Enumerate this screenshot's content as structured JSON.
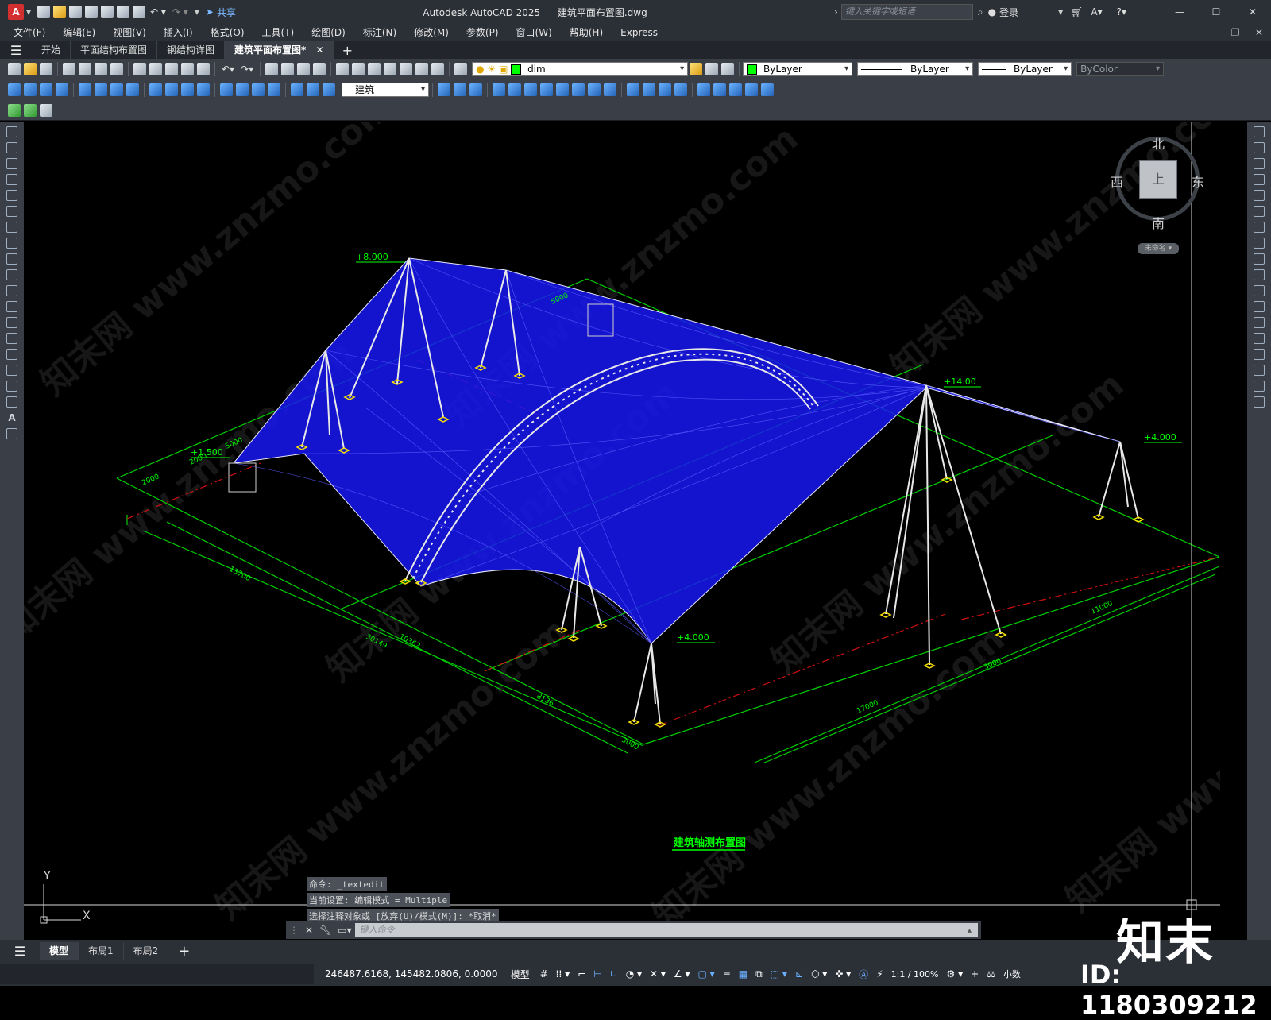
{
  "titlebar": {
    "app_title": "Autodesk AutoCAD 2025",
    "file_name": "建筑平面布置图.dwg",
    "share_label": "共享",
    "search_placeholder": "键入关键字或短语",
    "login_label": "登录"
  },
  "menubar": {
    "items": [
      "文件(F)",
      "编辑(E)",
      "视图(V)",
      "插入(I)",
      "格式(O)",
      "工具(T)",
      "绘图(D)",
      "标注(N)",
      "修改(M)",
      "参数(P)",
      "窗口(W)",
      "帮助(H)",
      "Express"
    ]
  },
  "doc_tabs": {
    "items": [
      "开始",
      "平面结构布置图",
      "钢结构详图",
      "建筑平面布置图*"
    ],
    "active_index": 3
  },
  "toolbar1": {
    "layer_name": "dim",
    "color": "ByLayer",
    "linetype": "ByLayer",
    "lineweight": "ByLayer",
    "plotstyle": "ByColor"
  },
  "toolbar2": {
    "textstyle": "建筑"
  },
  "viewcube": {
    "north": "北",
    "south": "南",
    "east": "东",
    "west": "西",
    "face": "上",
    "ucs_label": "未命名"
  },
  "drawing": {
    "title": "建筑轴测布置图",
    "elevations": [
      "+8.000",
      "+1.500",
      "+14.00",
      "+4.000",
      "+4.000"
    ],
    "dimensions": [
      "13700",
      "30149",
      "10362",
      "8136",
      "3000",
      "17000",
      "11000",
      "3000",
      "2000",
      "2000",
      "5000",
      "5000"
    ],
    "colors": {
      "membrane": "#1a1aff",
      "mesh": "#3a3aff",
      "frame": "#e8e8e8",
      "grid": "#00d000",
      "axis": "#d01010",
      "base": "#f5e000"
    }
  },
  "axis_labels": {
    "y": "Y",
    "x": "X"
  },
  "command": {
    "history": [
      "命令: _textedit",
      "当前设置: 编辑模式 = Multiple",
      "选择注释对象或 [放弃(U)/模式(M)]: *取消*"
    ],
    "placeholder": "键入命令"
  },
  "layout_tabs": {
    "items": [
      "模型",
      "布局1",
      "布局2"
    ],
    "active_index": 0
  },
  "status": {
    "coords": "246487.6168, 145482.0806, 0.0000",
    "model": "模型",
    "scale": "1:1 / 100%",
    "units": "小数"
  },
  "watermark": {
    "brand": "知末",
    "id": "ID: 1180309212",
    "site": "知末网 www.znzmo.com"
  }
}
